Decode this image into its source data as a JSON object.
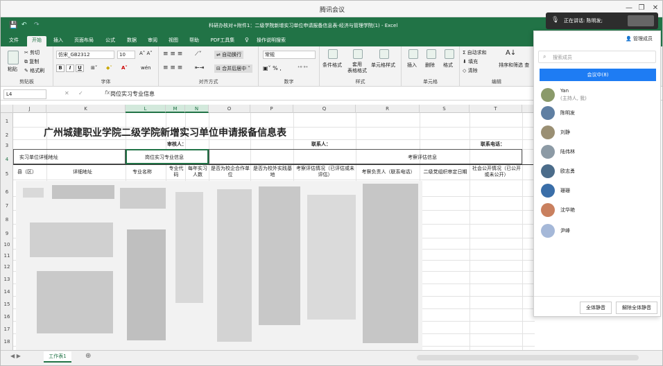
{
  "meeting": {
    "title": "腾讯会议",
    "speaking": "正在讲话: 陈明发;",
    "manage_members": "管理成员",
    "search_placeholder": "搜索成员",
    "in_meeting": "会议中(8)",
    "mute_all": "全体静音",
    "unmute_all": "解除全体静音",
    "members": [
      {
        "name": "Yan",
        "sub": "(主持人, 我)",
        "color": "#8a9a6a"
      },
      {
        "name": "陈明发",
        "color": "#5f7fa2"
      },
      {
        "name": "刘静",
        "color": "#9a8f73"
      },
      {
        "name": "陆伟林",
        "color": "#8c9aa5"
      },
      {
        "name": "欧志勇",
        "color": "#4b6c8a"
      },
      {
        "name": "珊珊",
        "color": "#3a6ea8"
      },
      {
        "name": "沈华艳",
        "color": "#c9805f"
      },
      {
        "name": "尹峰",
        "color": "#a5b8d8"
      }
    ]
  },
  "excel": {
    "title": "科研办核对+附件1：二级学院新增实习单位申请报备信息表-经济与管理学院(1)  -  Excel",
    "tabs": [
      "文件",
      "开始",
      "插入",
      "页面布局",
      "公式",
      "数据",
      "审阅",
      "视图",
      "帮助",
      "PDF工具集",
      "操作说明搜索"
    ],
    "ribbon": {
      "clipboard": {
        "paste": "粘贴",
        "cut": "剪切",
        "copy": "复制",
        "format_painter": "格式刷",
        "label": "剪贴板"
      },
      "font": {
        "name": "仿宋_GB2312",
        "size": "10",
        "label": "字体"
      },
      "alignment": {
        "wrap": "自动换行",
        "merge": "合并后居中",
        "label": "对齐方式"
      },
      "number": {
        "format": "常规",
        "label": "数字"
      },
      "styles": {
        "conditional": "条件格式",
        "table": "套用\n表格格式",
        "cell_styles": "单元格样式",
        "label": "样式"
      },
      "cells": {
        "insert": "插入",
        "delete": "删除",
        "format": "格式",
        "label": "单元格"
      },
      "editing": {
        "autosum": "自动求和",
        "fill": "填充",
        "clear": "清除",
        "sort": "排序和筛选",
        "find": "查",
        "label": "编辑"
      }
    },
    "namebox": "L4",
    "fx": "fx",
    "formula": "岗位实习专业信息",
    "columns": [
      "J",
      "K",
      "L",
      "M",
      "N",
      "O",
      "P",
      "Q",
      "R",
      "S",
      "T"
    ],
    "rows": [
      "1",
      "2",
      "3",
      "4",
      "5",
      "6",
      "7",
      "8",
      "9",
      "10",
      "11",
      "12",
      "13",
      "14",
      "15",
      "16",
      "17",
      "18"
    ],
    "sheet_title": "广州城建职业学院二级学院新增实习单位申请报备信息表",
    "reviewer": "审核人：",
    "contact": "联系人：",
    "phone": "联系电话：",
    "group_headers": {
      "address": "实习单位详细地址",
      "major": "岗位实习专业信息",
      "inspect": "考察评估信息"
    },
    "headers": [
      "县（区）",
      "详细地址",
      "专业名称",
      "专业代码",
      "每年实习人数",
      "是否为校企合作单位",
      "是否为校外实践基地",
      "考察评估情况（已评估或未评估）",
      "考察负责人（联系电话）",
      "二级党组织审定日期",
      "社会公开情况（已公开或未公开）"
    ],
    "sheet_tab": "工作表1"
  }
}
